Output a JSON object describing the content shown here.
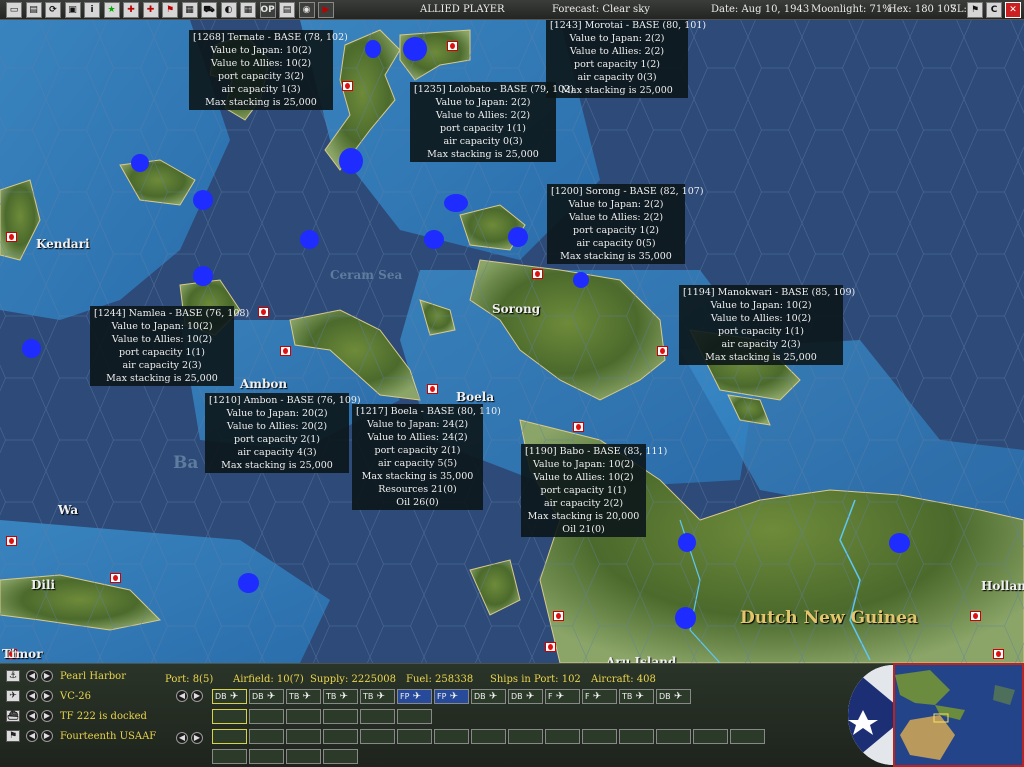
{
  "topbar": {
    "player": "ALLIED PLAYER",
    "forecast": "Forecast: Clear sky",
    "date": "Date: Aug 10, 1943",
    "moonlight": "Moonlight: 71%",
    "hex": "Hex: 180 107",
    "sl": "SL:",
    "buttons": [
      "▭",
      "▤",
      "⟳",
      "▣",
      "i",
      "★",
      "✚",
      "✚",
      "⚑",
      "▦",
      "⛟",
      "◐",
      "▦",
      "OP",
      "▤",
      "◉",
      "▶"
    ],
    "right_buttons": [
      "⚑",
      "C",
      "✕"
    ]
  },
  "map": {
    "labels": [
      {
        "text": "Kendari",
        "kind": "place"
      },
      {
        "text": "Ceram Sea",
        "kind": "sea"
      },
      {
        "text": "Sorong",
        "kind": "place"
      },
      {
        "text": "Ambon",
        "kind": "place"
      },
      {
        "text": "Boela",
        "kind": "place"
      },
      {
        "text": "Dili",
        "kind": "place"
      },
      {
        "text": "Dutch New Guinea",
        "kind": "region"
      },
      {
        "text": "Hollan",
        "kind": "place"
      },
      {
        "text": "Timor",
        "kind": "place"
      },
      {
        "text": "Aru Island",
        "kind": "place"
      },
      {
        "text": "Wa",
        "kind": "place"
      },
      {
        "text": "Ba",
        "kind": "place"
      }
    ],
    "bases": [
      {
        "lines": [
          "[1268] Ternate - BASE (78, 102)",
          "Value to Japan: 10(2)",
          "Value to Allies: 10(2)",
          "port capacity 3(2)",
          "air capacity 1(3)",
          "Max stacking is 25,000"
        ]
      },
      {
        "lines": [
          "[1243] Morotai - BASE (80, 101)",
          "Value to Japan: 2(2)",
          "Value to Allies: 2(2)",
          "port capacity 1(2)",
          "air capacity 0(3)",
          "Max stacking is 25,000"
        ]
      },
      {
        "lines": [
          "[1235] Lolobato - BASE (79, 102)",
          "Value to Japan: 2(2)",
          "Value to Allies: 2(2)",
          "port capacity 1(1)",
          "air capacity 0(3)",
          "Max stacking is 25,000"
        ]
      },
      {
        "lines": [
          "[1200] Sorong - BASE (82, 107)",
          "Value to Japan: 2(2)",
          "Value to Allies: 2(2)",
          "port capacity 1(2)",
          "air capacity 0(5)",
          "Max stacking is 35,000"
        ]
      },
      {
        "lines": [
          "[1194] Manokwari - BASE (85, 109)",
          "Value to Japan: 10(2)",
          "Value to Allies: 10(2)",
          "port capacity 1(1)",
          "air capacity 2(3)",
          "Max stacking is 25,000"
        ]
      },
      {
        "lines": [
          "[1244] Namlea - BASE (76, 108)",
          "Value to Japan: 10(2)",
          "Value to Allies: 10(2)",
          "port capacity 1(1)",
          "air capacity 2(3)",
          "Max stacking is 25,000"
        ]
      },
      {
        "lines": [
          "[1210] Ambon - BASE (76, 109)",
          "Value to Japan: 20(2)",
          "Value to Allies: 20(2)",
          "port capacity 2(1)",
          "air capacity 4(3)",
          "Max stacking is 25,000"
        ]
      },
      {
        "lines": [
          "[1217] Boela - BASE (80, 110)",
          "Value to Japan: 24(2)",
          "Value to Allies: 24(2)",
          "port capacity 2(1)",
          "air capacity 5(5)",
          "Max stacking is 35,000",
          "Resources 21(0)",
          "Oil 26(0)"
        ]
      },
      {
        "lines": [
          "[1190] Babo - BASE (83, 111)",
          "Value to Japan: 10(2)",
          "Value to Allies: 10(2)",
          "port capacity 1(1)",
          "air capacity 2(2)",
          "Max stacking is 20,000",
          "Oil 21(0)"
        ]
      }
    ]
  },
  "panel": {
    "rows": [
      {
        "icon": "anchor-icon",
        "glyph": "⚓",
        "name": "Pearl Harbor"
      },
      {
        "icon": "plane-icon",
        "glyph": "✈",
        "name": "VC-26"
      },
      {
        "icon": "ship-icon",
        "glyph": "⛴",
        "name": "TF 222 is docked"
      },
      {
        "icon": "flag-icon",
        "glyph": "⚑",
        "name": "Fourteenth USAAF"
      }
    ],
    "stats": {
      "port": "Port: 8(5)",
      "airfield": "Airfield: 10(7)",
      "supply": "Supply: 2225008",
      "fuel": "Fuel: 258338",
      "ships": "Ships in Port: 102",
      "aircraft": "Aircraft: 408"
    },
    "air_slots": [
      "DB",
      "DB",
      "TB",
      "TB",
      "TB",
      "FP",
      "FP",
      "DB",
      "DB",
      "F",
      "F",
      "TB",
      "DB"
    ],
    "ship_slots": [
      "",
      "",
      "",
      "",
      "",
      ""
    ],
    "ground_slots": [
      "",
      "",
      "",
      "",
      "",
      "",
      "",
      "",
      "",
      "",
      "",
      "",
      "",
      "",
      ""
    ],
    "misc_slots": [
      "",
      "",
      "",
      ""
    ]
  }
}
